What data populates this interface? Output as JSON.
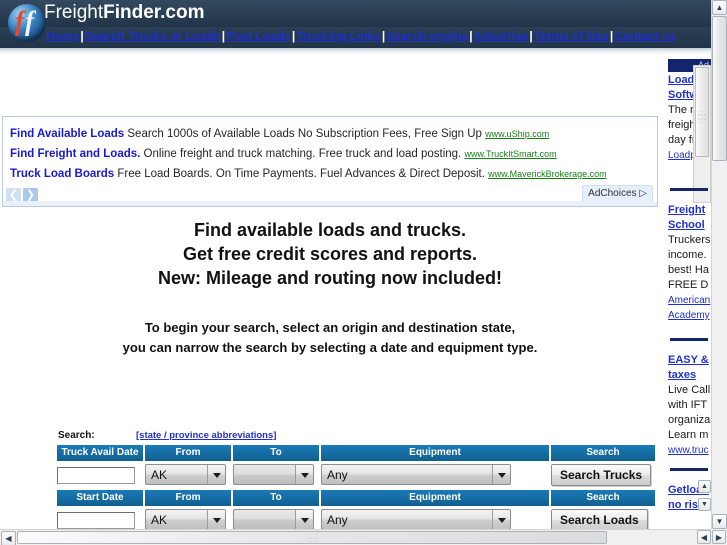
{
  "site": {
    "brand_light": "Freight",
    "brand_bold": "Finder.com",
    "logo_letter_1": "f",
    "logo_letter_2": "f"
  },
  "nav": {
    "items": [
      "Home",
      "Search Trucks or Loads",
      "Post Loads",
      "Trucking Links",
      "Search engine",
      "Advertise",
      "Terms of Use",
      "Contact us"
    ],
    "separator": "|"
  },
  "ads": {
    "rows": [
      {
        "title": "Find Available Loads",
        "body": "Search 1000s of Available Loads No Subscription Fees, Free Sign Up",
        "url": "www.uShip.com"
      },
      {
        "title": "Find Freight and Loads.",
        "body": "Online freight and truck matching. Free truck and load posting.",
        "url": "www.TruckItSmart.com"
      },
      {
        "title": "Truck Load Boards",
        "body": "Free Load Boards. On Time Payments. Fuel Advances & Direct Deposit.",
        "url": "www.MaverickBrokerage.com"
      }
    ],
    "prev_arrow": "❮",
    "next_arrow": "❯",
    "adchoices_label": "AdChoices",
    "adchoices_glyph": "▷"
  },
  "headline": {
    "line1": "Find available loads and trucks.",
    "line2": "Get free credit scores and reports.",
    "line3": "New: Mileage and routing now included!"
  },
  "subheadline": {
    "line1": "To begin your search, select an origin and destination state,",
    "line2": "you can narrow the search by selecting a date and equipment type."
  },
  "search_form": {
    "label": "Search:",
    "abbrev_link": "[state / province abbreviations]",
    "rows": [
      {
        "date_header": "Truck Avail Date",
        "from_header": "From",
        "to_header": "To",
        "equipment_header": "Equipment",
        "search_header": "Search",
        "date_value": "",
        "date_placeholder": "",
        "from_value": "AK",
        "to_value": "",
        "equipment_value": "Any",
        "button_label": "Search Trucks"
      },
      {
        "date_header": "Start Date",
        "from_header": "From",
        "to_header": "To",
        "equipment_header": "Equipment",
        "search_header": "Search",
        "date_value": "",
        "date_placeholder": "",
        "from_value": "AK",
        "to_value": "",
        "equipment_value": "Any",
        "button_label": "Search Loads"
      }
    ],
    "header_color": "#156ba3"
  },
  "sidebar": {
    "ads_header": "Ad",
    "blocks": [
      {
        "link1": "LoadPil",
        "link2": "Softwar",
        "text1": "The nex",
        "text2": "freight b",
        "text3": "day free",
        "url": "Loadpilo"
      },
      {
        "link1": "Freight",
        "link2": "School",
        "text1": "Truckers",
        "text2": "income.",
        "text3": "best! Ha",
        "text4": "FREE D",
        "url1": "American",
        "url2": "Academy"
      },
      {
        "link1": "EASY &",
        "link2": "taxes",
        "text1": "Live Call",
        "text2": "with IFT",
        "text3": "organiza",
        "text4": "Learn m",
        "url": "www.truc"
      },
      {
        "link1": "Getload",
        "link2": "no risk t"
      }
    ]
  },
  "scrollbars": {
    "up_arrow": "▲",
    "down_arrow": "▼",
    "left_arrow": "◀",
    "right_arrow": "▶"
  },
  "colors": {
    "header_bar": "#2c4257",
    "link_blue": "#1f2fd0",
    "table_header_blue": "#156ba3",
    "ad_url_green": "#178217",
    "sidebar_rule": "#16246b"
  }
}
